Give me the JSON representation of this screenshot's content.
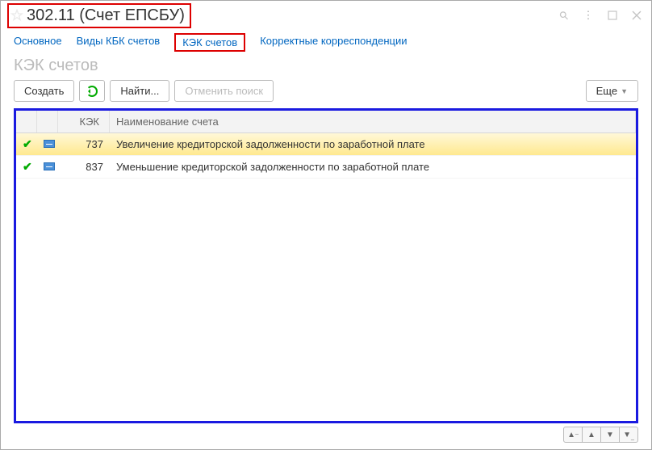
{
  "title": "302.11 (Счет ЕПСБУ)",
  "tabs": [
    {
      "label": "Основное"
    },
    {
      "label": "Виды КБК счетов"
    },
    {
      "label": "КЭК счетов",
      "active": true
    },
    {
      "label": "Корректные корреспонденции"
    }
  ],
  "section_title": "КЭК счетов",
  "toolbar": {
    "create": "Создать",
    "find": "Найти...",
    "cancel_search": "Отменить поиск",
    "more": "Еще"
  },
  "columns": {
    "kek": "КЭК",
    "name": "Наименование счета"
  },
  "rows": [
    {
      "kek": "737",
      "name": "Увеличение кредиторской задолженности по заработной плате",
      "selected": true
    },
    {
      "kek": "837",
      "name": "Уменьшение кредиторской задолженности по заработной плате",
      "selected": false
    }
  ]
}
